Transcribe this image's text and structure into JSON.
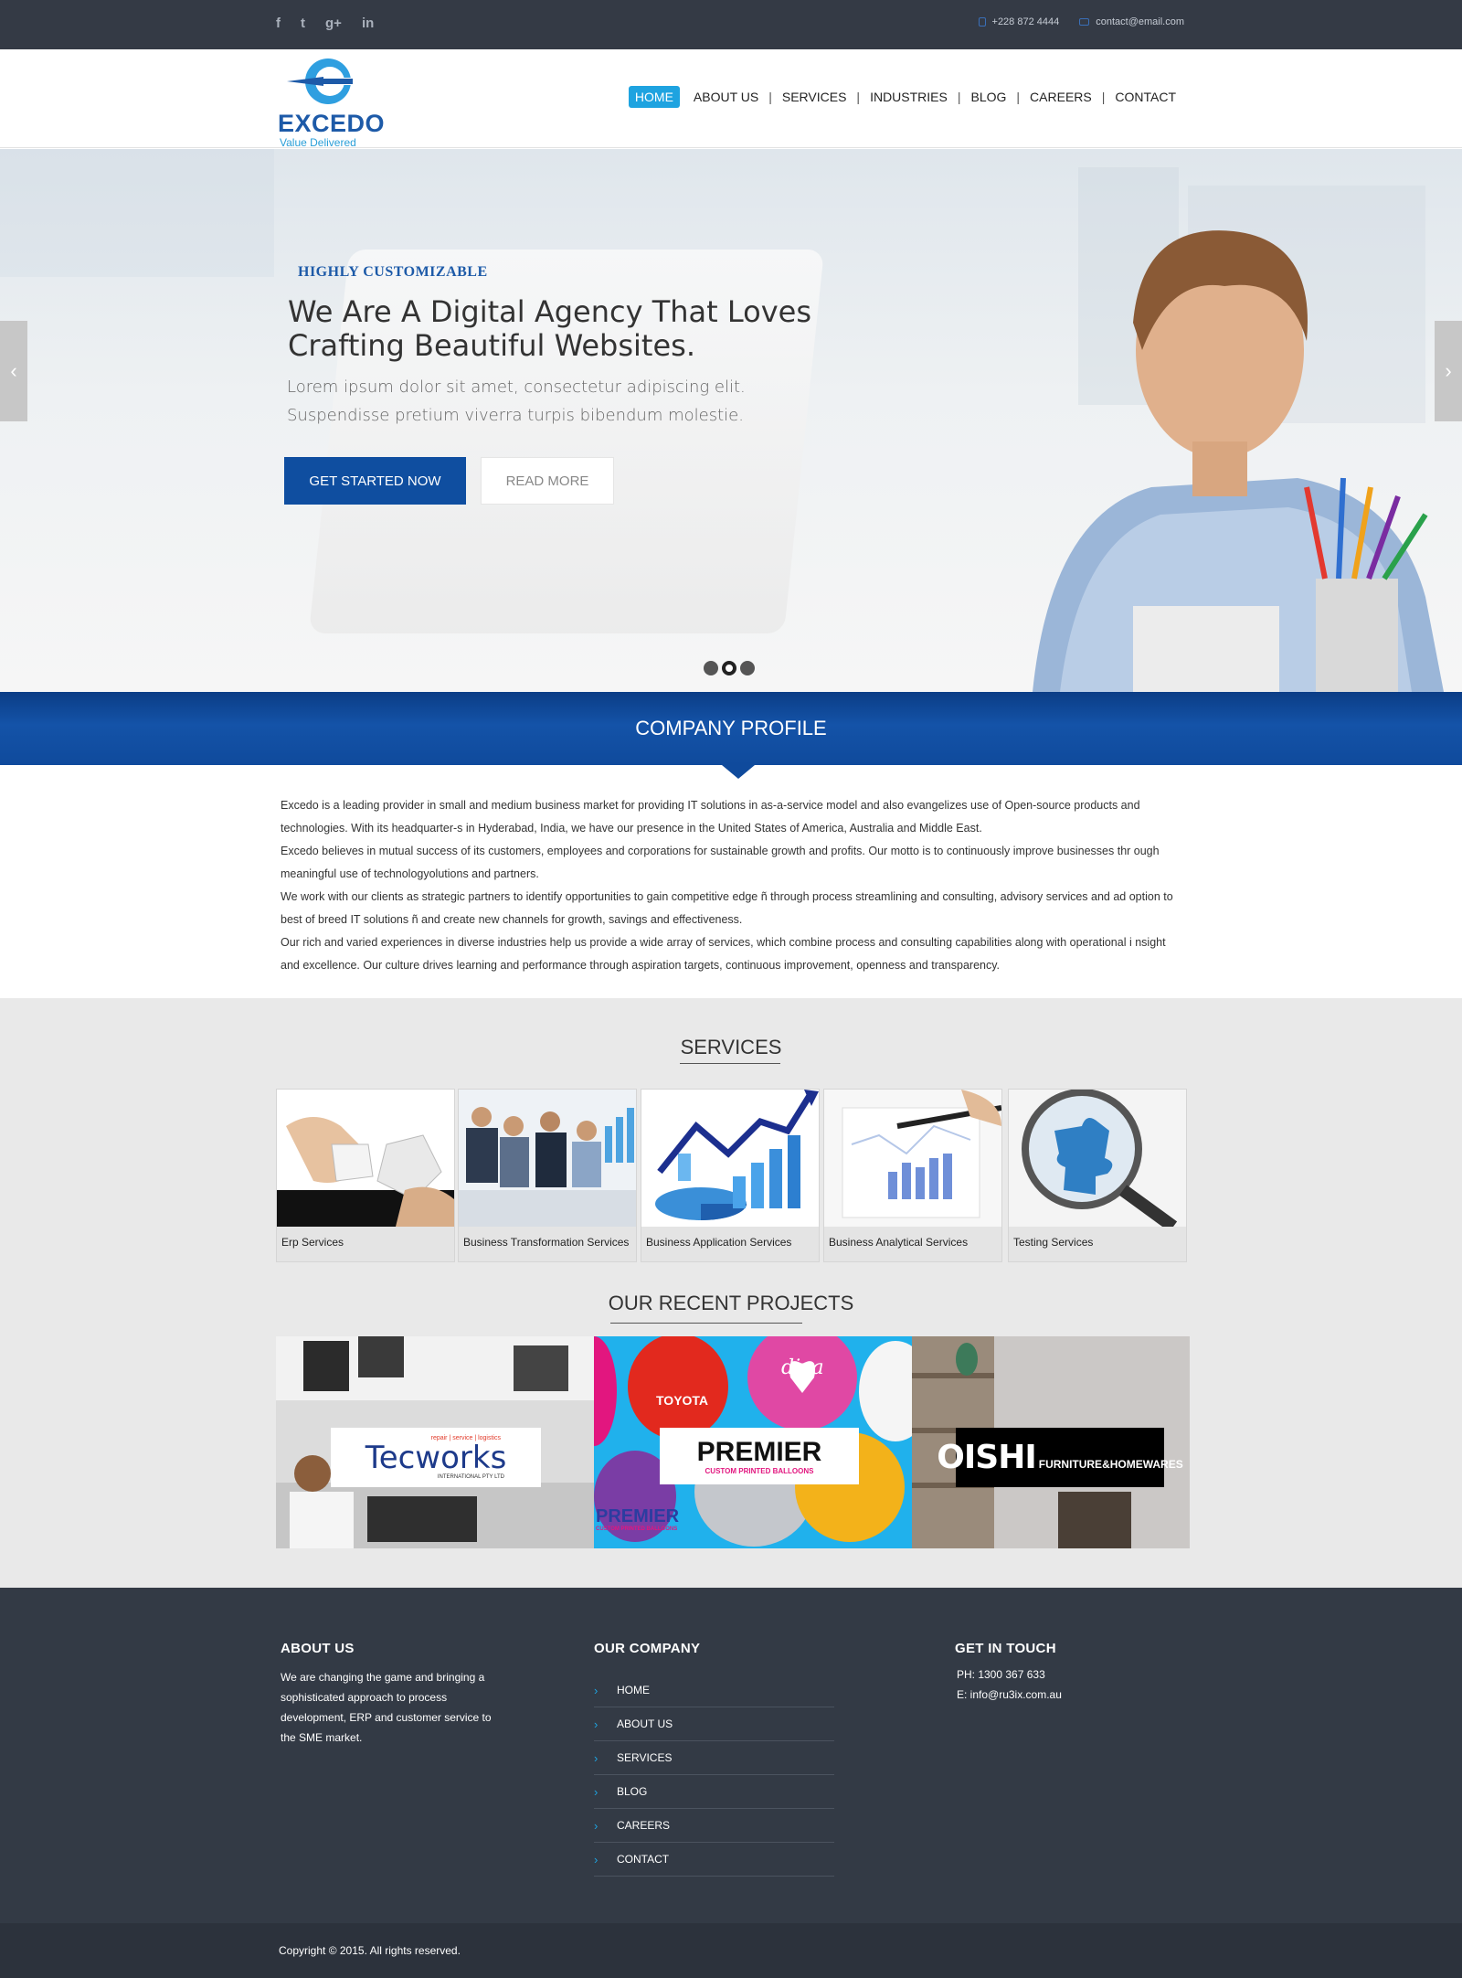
{
  "topbar": {
    "social": [
      {
        "icon": "facebook-icon",
        "glyph": "f"
      },
      {
        "icon": "twitter-icon",
        "glyph": "t"
      },
      {
        "icon": "google-plus-icon",
        "glyph": "g+"
      },
      {
        "icon": "linkedin-icon",
        "glyph": "in"
      }
    ],
    "phone": "+228 872 4444",
    "email": "contact@email.com"
  },
  "logo": {
    "word": "EXCEDO",
    "tagline": "Value Delivered"
  },
  "nav": [
    "HOME",
    "ABOUT US",
    "SERVICES",
    "INDUSTRIES",
    "BLOG",
    "CAREERS",
    "CONTACT"
  ],
  "hero": {
    "kicker": "HIGHLY CUSTOMIZABLE",
    "title": "We Are A Digital Agency That Loves Crafting Beautiful Websites.",
    "subtitle": "Lorem ipsum dolor sit amet, consectetur adipiscing elit. Suspendisse pretium viverra turpis bibendum molestie.",
    "primary_button": "GET STARTED NOW",
    "secondary_button": "READ MORE",
    "prev_icon": "chevron-left-icon",
    "next_icon": "chevron-right-icon",
    "slides": 3,
    "active_slide": 2
  },
  "profile": {
    "title": "COMPANY PROFILE",
    "text": "Excedo is a leading provider in small and medium business market for providing IT solutions in as-a-service model and also evangelizes use of Open-source products and technologies. With its headquarter-s in Hyderabad, India, we have our presence in the United States of America, Australia and Middle East.\nExcedo believes in mutual success of its customers, employees and corporations for sustainable growth and profits. Our motto is to continuously improve businesses thr ough meaningful use of technologyolutions and partners.\nWe work with our clients as strategic partners to identify opportunities to gain competitive edge ñ through process streamlining and consulting, advisory services and ad option to best of breed IT solutions ñ and create new channels for growth, savings and effectiveness.\nOur rich and varied experiences in diverse industries help us provide a wide array of services, which combine process and consulting capabilities along with operational i nsight and excellence. Our culture drives learning and performance through aspiration targets, continuous improvement, openness and transparency."
  },
  "services": {
    "title": "SERVICES",
    "items": [
      {
        "label": "Erp Services"
      },
      {
        "label": "Business Transformation Services"
      },
      {
        "label": "Business  Application Services"
      },
      {
        "label": "Business Analytical Services"
      },
      {
        "label": "Testing Services"
      }
    ]
  },
  "projects": {
    "title": "OUR RECENT PROJECTS",
    "items": [
      {
        "name": "Tecworks",
        "tagline": "repair | service | logistics",
        "sub": "INTERNATIONAL PTY LTD"
      },
      {
        "name": "PREMIER",
        "sub": "CUSTOM PRINTED BALLOONS",
        "balloon_toyota": "TOYOTA",
        "balloon_diva": "diva"
      },
      {
        "name": "OISHI",
        "sub": "FURNITURE&HOMEWARES"
      }
    ]
  },
  "footer": {
    "about_title": "ABOUT US",
    "about_text": "We are changing the game and bringing a sophisticated approach to process development, ERP and customer service to the SME market.",
    "company_title": "OUR COMPANY",
    "links": [
      "HOME",
      "ABOUT US",
      "SERVICES",
      "BLOG",
      "CAREERS",
      "CONTACT"
    ],
    "touch_title": "GET IN TOUCH",
    "phone": "PH: 1300 367 633",
    "email": "E: info@ru3ix.com.au",
    "copyright": "Copyright © 2015. All rights reserved."
  },
  "colors": {
    "brand_blue": "#0f4ea0",
    "accent_cyan": "#1ea3e0",
    "dark_bg": "#343a45"
  }
}
